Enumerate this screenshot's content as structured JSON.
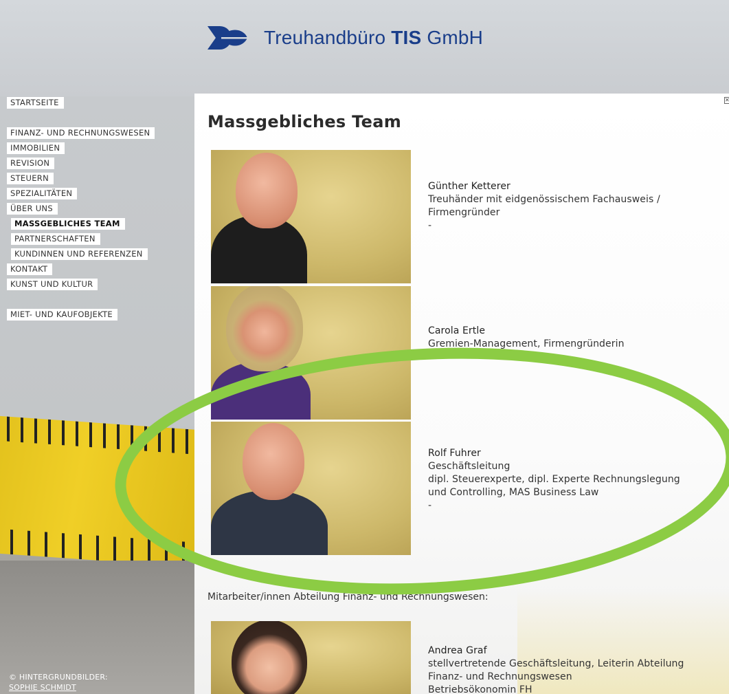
{
  "brand": {
    "name_prefix": "Treuhandbüro ",
    "name_bold": "TIS",
    "name_suffix": " GmbH",
    "logo": "tis-logo-icon",
    "color": "#1a3e8a"
  },
  "nav": {
    "items": [
      {
        "label": "STARTSEITE"
      },
      {
        "label": "FINANZ- UND RECHNUNGSWESEN"
      },
      {
        "label": "IMMOBILIEN"
      },
      {
        "label": "REVISION"
      },
      {
        "label": "STEUERN"
      },
      {
        "label": "SPEZIALITÄTEN"
      },
      {
        "label": "ÜBER UNS"
      },
      {
        "label": "MASSGEBLICHES TEAM"
      },
      {
        "label": "PARTNERSCHAFTEN"
      },
      {
        "label": "KUNDINNEN UND REFERENZEN"
      },
      {
        "label": "KONTAKT"
      },
      {
        "label": "KUNST UND KULTUR"
      },
      {
        "label": "MIET- UND KAUFOBJEKTE"
      }
    ]
  },
  "credits": {
    "prefix": "© HINTERGRUNDBILDER:",
    "author": "SOPHIE SCHMIDT"
  },
  "page": {
    "title": "Massgebliches Team"
  },
  "team": [
    {
      "name": "Günther Ketterer",
      "line1": "Treuhänder mit eidgenössischem Fachausweis /",
      "line2": "Firmengründer",
      "line3": "-"
    },
    {
      "name": "Carola Ertle",
      "line1": "Gremien-Management, Firmengründerin",
      "line2": "-"
    },
    {
      "name": "Rolf Fuhrer",
      "line1": "Geschäftsleitung",
      "line2": "dipl. Steuerexperte, dipl. Experte Rechnungslegung",
      "line3": "und Controlling, MAS Business Law",
      "line4": "-"
    }
  ],
  "section_label": "Mitarbeiter/innen Abteilung Finanz- und Rechnungswesen:",
  "staff": [
    {
      "name": "Andrea Graf",
      "line1": "stellvertretende Geschäftsleitung, Leiterin Abteilung",
      "line2": "Finanz- und Rechnungswesen",
      "line3": "Betriebsökonomin FH"
    }
  ],
  "annotation": {
    "color": "#8ccc44"
  },
  "icons": {
    "close": "close-icon"
  }
}
